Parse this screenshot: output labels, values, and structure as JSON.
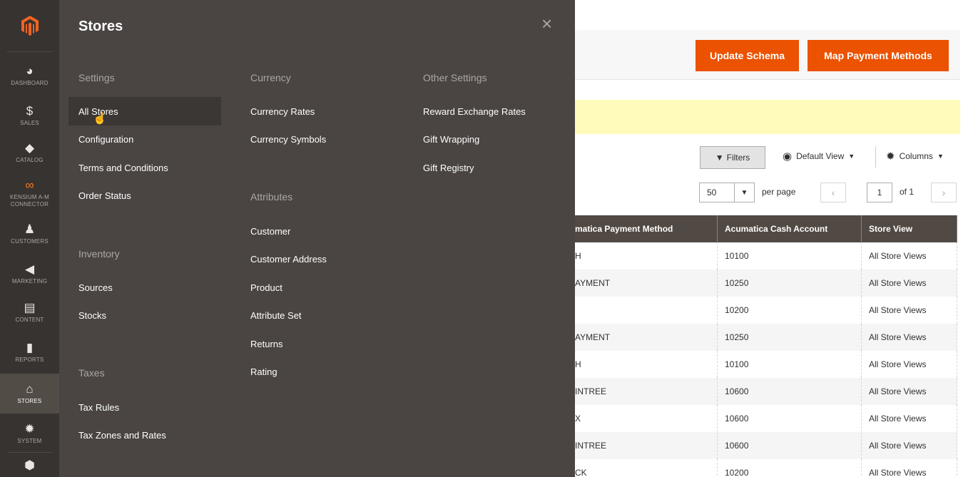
{
  "sidebar": {
    "items": [
      {
        "icon": "dashboard-icon",
        "glyph": "◕",
        "label": "DASHBOARD"
      },
      {
        "icon": "dollar-icon",
        "glyph": "$",
        "label": "SALES"
      },
      {
        "icon": "cube-icon",
        "glyph": "◆",
        "label": "CATALOG"
      },
      {
        "icon": "connector-icon",
        "glyph": "∞",
        "label": "KENSIUM A-M CONNECTOR"
      },
      {
        "icon": "person-icon",
        "glyph": "♟",
        "label": "CUSTOMERS"
      },
      {
        "icon": "megaphone-icon",
        "glyph": "◀",
        "label": "MARKETING"
      },
      {
        "icon": "content-icon",
        "glyph": "▤",
        "label": "CONTENT"
      },
      {
        "icon": "bar-chart-icon",
        "glyph": "▮",
        "label": "REPORTS"
      },
      {
        "icon": "store-icon",
        "glyph": "⌂",
        "label": "STORES"
      },
      {
        "icon": "gear-icon",
        "glyph": "✹",
        "label": "SYSTEM"
      },
      {
        "icon": "box-icon",
        "glyph": "⬢",
        "label": ""
      }
    ]
  },
  "flyout": {
    "title": "Stores",
    "close": "×",
    "settings": {
      "heading": "Settings",
      "links": [
        "All Stores",
        "Configuration",
        "Terms and Conditions",
        "Order Status"
      ]
    },
    "inventory": {
      "heading": "Inventory",
      "links": [
        "Sources",
        "Stocks"
      ]
    },
    "taxes": {
      "heading": "Taxes",
      "links": [
        "Tax Rules",
        "Tax Zones and Rates"
      ]
    },
    "currency": {
      "heading": "Currency",
      "links": [
        "Currency Rates",
        "Currency Symbols"
      ]
    },
    "attributes": {
      "heading": "Attributes",
      "links": [
        "Customer",
        "Customer Address",
        "Product",
        "Attribute Set",
        "Returns",
        "Rating"
      ]
    },
    "other": {
      "heading": "Other Settings",
      "links": [
        "Reward Exchange Rates",
        "Gift Wrapping",
        "Gift Registry"
      ]
    }
  },
  "header": {
    "update_schema": "Update Schema",
    "map_payment_methods": "Map Payment Methods",
    "accent_color": "#eb5202"
  },
  "toolbar": {
    "filters": "Filters",
    "default_view": "Default View",
    "columns": "Columns",
    "per_page_value": "50",
    "per_page_label": "per page",
    "page_current": "1",
    "page_of": "of 1"
  },
  "grid": {
    "columns": [
      "matica Payment Method",
      "Acumatica Cash Account",
      "Store View"
    ],
    "rows": [
      [
        "H",
        "10100",
        "All Store Views"
      ],
      [
        "AYMENT",
        "10250",
        "All Store Views"
      ],
      [
        "",
        "10200",
        "All Store Views"
      ],
      [
        "AYMENT",
        "10250",
        "All Store Views"
      ],
      [
        "H",
        "10100",
        "All Store Views"
      ],
      [
        "INTREE",
        "10600",
        "All Store Views"
      ],
      [
        "X",
        "10600",
        "All Store Views"
      ],
      [
        "INTREE",
        "10600",
        "All Store Views"
      ],
      [
        "CK",
        "10200",
        "All Store Views"
      ]
    ]
  }
}
